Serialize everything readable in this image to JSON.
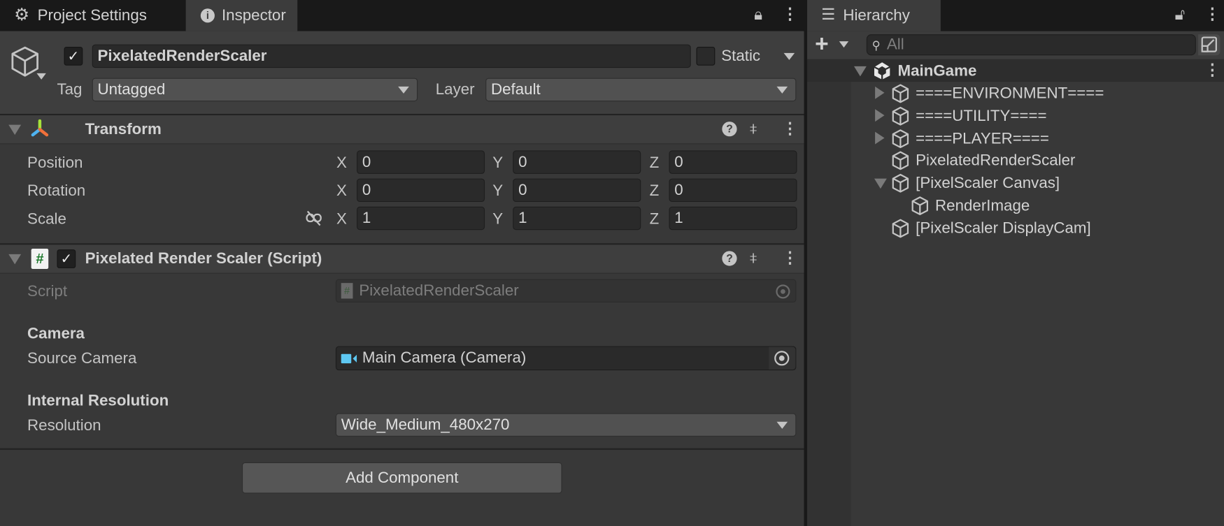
{
  "tabs": {
    "project_settings": "Project Settings",
    "inspector": "Inspector",
    "hierarchy": "Hierarchy"
  },
  "inspector": {
    "object_name": "PixelatedRenderScaler",
    "active": true,
    "static_label": "Static",
    "static": false,
    "tag_label": "Tag",
    "tag_value": "Untagged",
    "layer_label": "Layer",
    "layer_value": "Default",
    "transform": {
      "title": "Transform",
      "rows": [
        {
          "label": "Position",
          "x": "0",
          "y": "0",
          "z": "0"
        },
        {
          "label": "Rotation",
          "x": "0",
          "y": "0",
          "z": "0"
        },
        {
          "label": "Scale",
          "x": "1",
          "y": "1",
          "z": "1"
        }
      ],
      "axis_labels": [
        "X",
        "Y",
        "Z"
      ]
    },
    "script_component": {
      "title": "Pixelated Render Scaler (Script)",
      "enabled": true,
      "script_label": "Script",
      "script_value": "PixelatedRenderScaler",
      "camera_header": "Camera",
      "source_camera_label": "Source Camera",
      "source_camera_value": "Main Camera (Camera)",
      "resolution_header": "Internal Resolution",
      "resolution_label": "Resolution",
      "resolution_value": "Wide_Medium_480x270"
    },
    "add_component": "Add Component"
  },
  "hierarchy": {
    "search_placeholder": "All",
    "scene": "MainGame",
    "items": [
      {
        "label": "====ENVIRONMENT====",
        "expand": "collapsed"
      },
      {
        "label": "====UTILITY====",
        "expand": "collapsed"
      },
      {
        "label": "====PLAYER====",
        "expand": "collapsed"
      },
      {
        "label": "PixelatedRenderScaler",
        "expand": "none"
      },
      {
        "label": "[PixelScaler Canvas]",
        "expand": "expanded"
      },
      {
        "label": "RenderImage",
        "expand": "none"
      },
      {
        "label": "[PixelScaler DisplayCam]",
        "expand": "none"
      }
    ]
  },
  "colors": {
    "panel": "#383838",
    "header": "#3e3e3e",
    "field": "#2a2a2a",
    "camera_icon": "#5ec8f2",
    "script_icon_hash": "#1f7a2e"
  }
}
